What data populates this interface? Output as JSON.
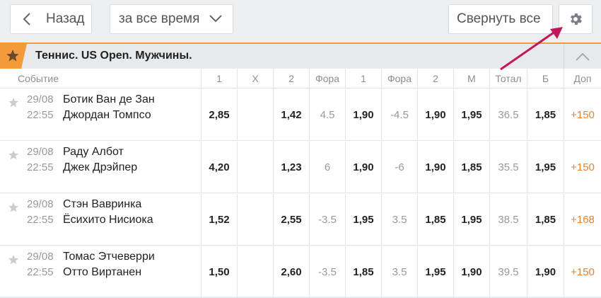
{
  "toolbar": {
    "back_label": "Назад",
    "period_label": "за все время",
    "collapse_label": "Свернуть все"
  },
  "section": {
    "title": "Теннис. US Open. Мужчины."
  },
  "columns": [
    "Событие",
    "1",
    "X",
    "2",
    "Фора",
    "1",
    "Фора",
    "2",
    "М",
    "Тотал",
    "Б",
    "Доп"
  ],
  "rows": [
    {
      "date": "29/08",
      "time": "22:55",
      "team1": "Ботик Ван де Зан",
      "team2": "Джордан Томпсо",
      "c1": "2,85",
      "cx": "",
      "c2": "1,42",
      "f1": "4.5",
      "f1o": "1,90",
      "f2": "-4.5",
      "f2o": "1,90",
      "m": "1,95",
      "total": "36.5",
      "b": "1,85",
      "more": "+150"
    },
    {
      "date": "29/08",
      "time": "22:55",
      "team1": "Раду Албот",
      "team2": "Джек Дрэйпер",
      "c1": "4,20",
      "cx": "",
      "c2": "1,23",
      "f1": "6",
      "f1o": "1,90",
      "f2": "-6",
      "f2o": "1,90",
      "m": "1,85",
      "total": "35.5",
      "b": "1,95",
      "more": "+150"
    },
    {
      "date": "29/08",
      "time": "22:55",
      "team1": "Стэн Вавринка",
      "team2": "Ёсихито Нисиока",
      "c1": "1,52",
      "cx": "",
      "c2": "2,55",
      "f1": "-3.5",
      "f1o": "1,95",
      "f2": "3.5",
      "f2o": "1,85",
      "m": "1,95",
      "total": "38.5",
      "b": "1,85",
      "more": "+168"
    },
    {
      "date": "29/08",
      "time": "22:55",
      "team1": "Томас Этчеверри",
      "team2": "Отто Виртанен",
      "c1": "1,50",
      "cx": "",
      "c2": "2,60",
      "f1": "-3.5",
      "f1o": "1,85",
      "f2": "3.5",
      "f2o": "1,95",
      "m": "1,90",
      "total": "39.5",
      "b": "1,90",
      "more": "+150"
    }
  ],
  "colors": {
    "accent": "#f39a3a",
    "annotation_arrow": "#c2185b",
    "more_text": "#e8832a"
  }
}
